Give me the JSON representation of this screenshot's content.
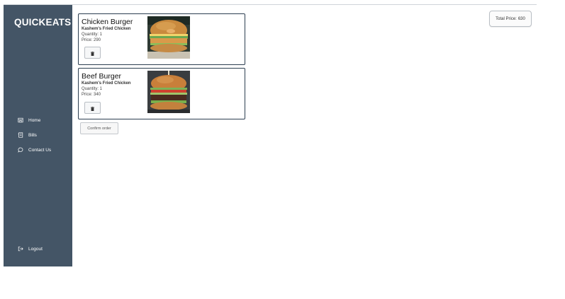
{
  "app": {
    "brand": "QUICKEATS"
  },
  "sidebar": {
    "items": [
      {
        "label": "Home",
        "icon": "home-icon"
      },
      {
        "label": "Bills",
        "icon": "receipt-icon"
      },
      {
        "label": "Contact Us",
        "icon": "chat-icon"
      }
    ],
    "logout": {
      "label": "Logout",
      "icon": "logout-icon"
    }
  },
  "cart": {
    "items": [
      {
        "name": "Chicken Burger",
        "restaurant": "Kashem's Fried Chicken",
        "quantity": "Quantity: 1",
        "price": "Price: 290",
        "image": "chicken-burger-photo"
      },
      {
        "name": "Beef Burger",
        "restaurant": "Kashem's Fried Chicken",
        "quantity": "Quantity: 1",
        "price": "Price: 340",
        "image": "beef-burger-photo"
      }
    ],
    "confirm_label": "Confirm order",
    "total_label": "Total Price:",
    "total_value": "630"
  },
  "colors": {
    "sidebar": "#445566",
    "card_border": "#2c3e50",
    "background": "#ffffff"
  }
}
